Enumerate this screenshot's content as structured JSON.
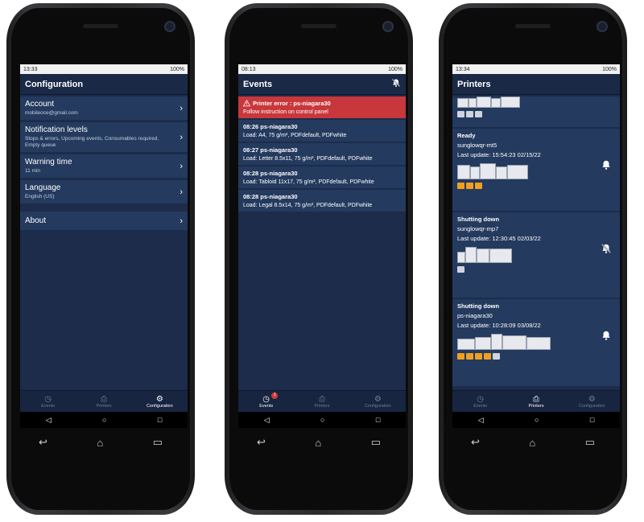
{
  "colors": {
    "appbar": "#1a2946",
    "screen": "#1c2c4a",
    "item": "#243a5e",
    "alert": "#c8373b",
    "accent": "#f0a020"
  },
  "phone1": {
    "status": {
      "time": "13:33",
      "battery": "100%"
    },
    "title": "Configuration",
    "items": [
      {
        "title": "Account",
        "sub": "mobileoce@gmail.com"
      },
      {
        "title": "Notification levels",
        "sub": "Stops & errors, Upcoming events, Consumables required, Empty queue"
      },
      {
        "title": "Warning time",
        "sub": "11 min"
      },
      {
        "title": "Language",
        "sub": "English (US)"
      },
      {
        "title": "About",
        "sub": ""
      }
    ],
    "tabs": [
      {
        "label": "Events",
        "icon": "clock-icon"
      },
      {
        "label": "Printers",
        "icon": "printer-icon"
      },
      {
        "label": "Configuration",
        "icon": "gear-icon"
      }
    ],
    "active_tab": 2
  },
  "phone2": {
    "status": {
      "time": "08:13",
      "battery": "100%"
    },
    "title": "Events",
    "alert": {
      "title": "Printer error : ps-niagara30",
      "sub": "Follow instruction on control panel"
    },
    "events": [
      {
        "title": "08:26 ps-niagara30",
        "sub": "Load: A4, 75 g/m², PDFdefault, PDFwhite"
      },
      {
        "title": "08:27 ps-niagara30",
        "sub": "Load: Letter 8.5x11, 75 g/m², PDFdefault, PDFwhite"
      },
      {
        "title": "08:28 ps-niagara30",
        "sub": "Load: Tabloid 11x17, 75 g/m², PDFdefault, PDFwhite"
      },
      {
        "title": "08:28 ps-niagara30",
        "sub": "Load: Legal 8.5x14, 75 g/m², PDFdefault, PDFwhite"
      }
    ],
    "tabs": [
      {
        "label": "Events",
        "icon": "clock-icon",
        "badge": "1"
      },
      {
        "label": "Printers",
        "icon": "printer-icon"
      },
      {
        "label": "Configuration",
        "icon": "gear-icon"
      }
    ],
    "active_tab": 0
  },
  "phone3": {
    "status": {
      "time": "13:34",
      "battery": "100%"
    },
    "title": "Printers",
    "printers": [
      {
        "state": "Ready",
        "name": "sunglowqr-mt5",
        "update": "Last update: 15:54:23 02/15/22",
        "bell": "bell-icon"
      },
      {
        "state": "Shutting down",
        "name": "sunglowqr-mp7",
        "update": "Last update: 12:30:45 02/03/22",
        "bell": "bell-off-icon"
      },
      {
        "state": "Shutting down",
        "name": "ps-niagara30",
        "update": "Last update: 10:28:09 03/08/22",
        "bell": "bell-icon"
      }
    ],
    "tabs": [
      {
        "label": "Events",
        "icon": "clock-icon"
      },
      {
        "label": "Printers",
        "icon": "printer-icon"
      },
      {
        "label": "Configuration",
        "icon": "gear-icon"
      }
    ],
    "active_tab": 1
  }
}
